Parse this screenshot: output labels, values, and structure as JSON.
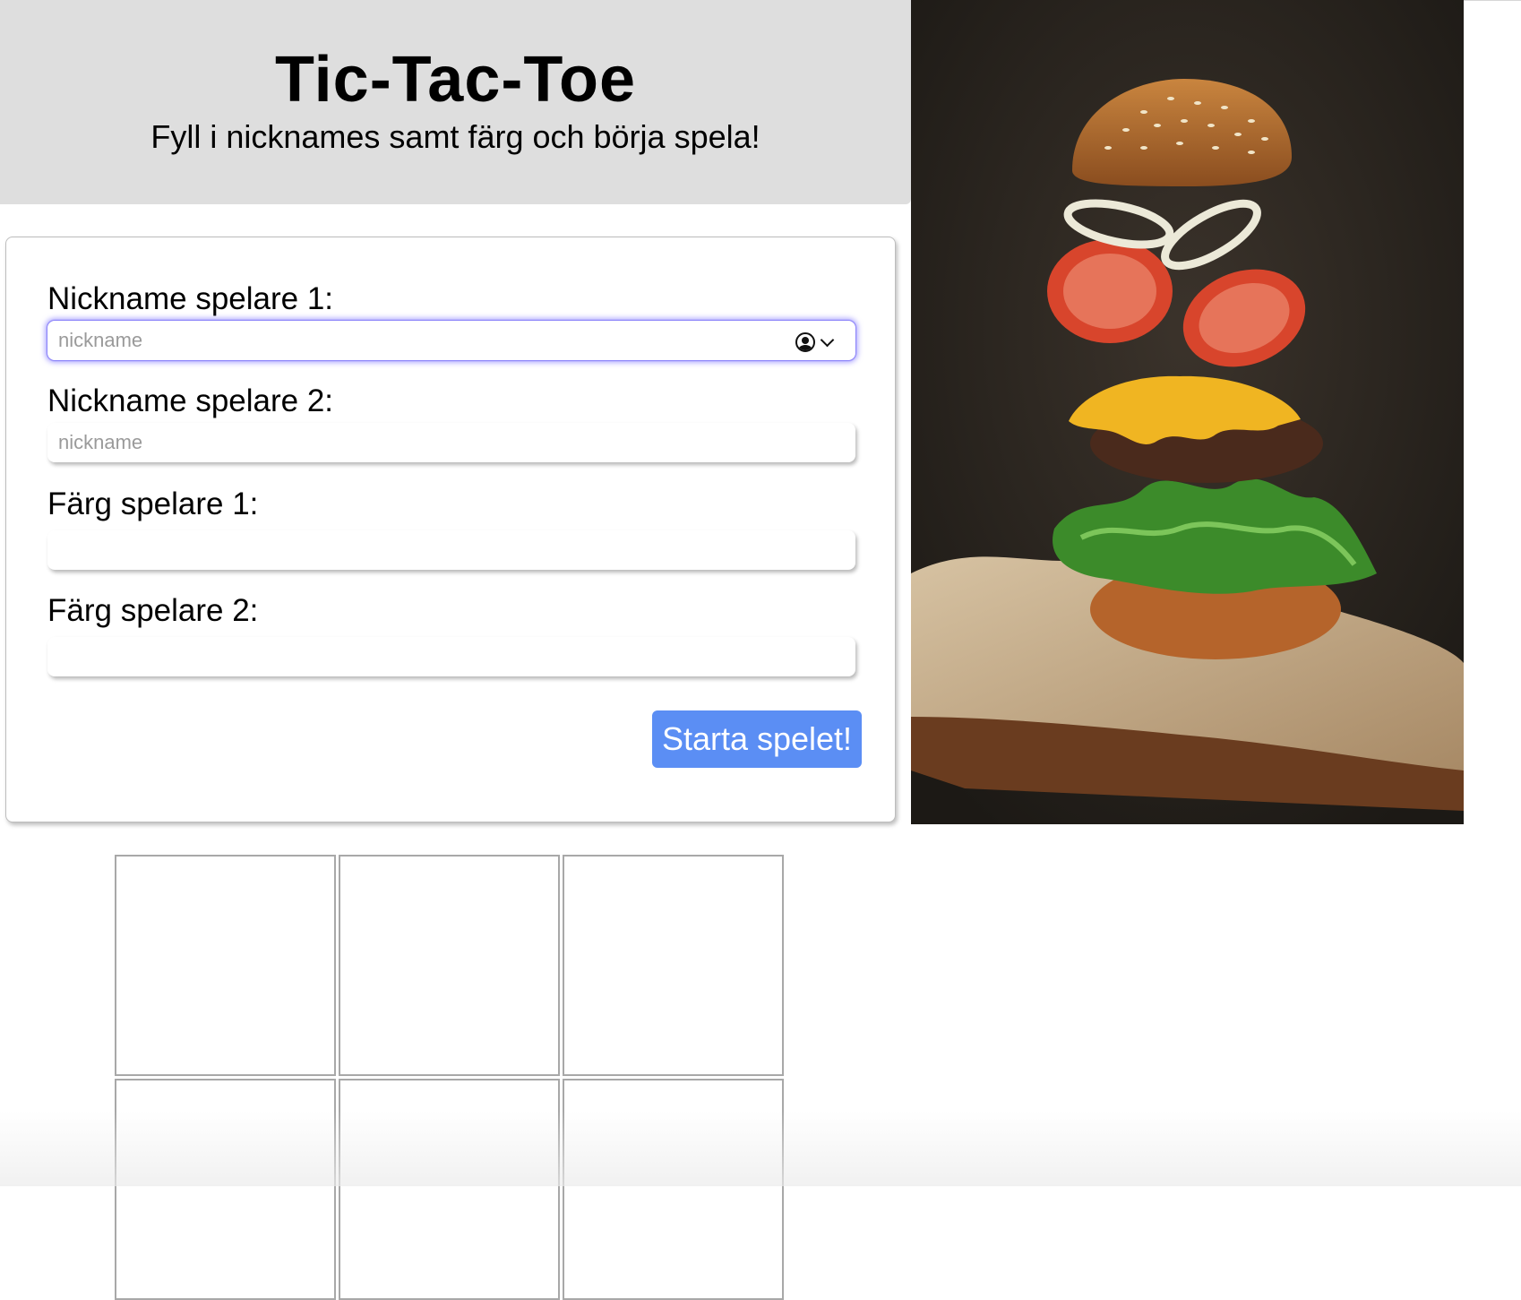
{
  "header": {
    "title": "Tic-Tac-Toe",
    "subtitle": "Fyll i nicknames samt färg och börja spela!"
  },
  "form": {
    "player1_nickname_label": "Nickname spelare 1:",
    "player1_nickname_placeholder": "nickname",
    "player2_nickname_label": "Nickname spelare 2:",
    "player2_nickname_placeholder": "nickname",
    "player1_color_label": "Färg spelare 1:",
    "player2_color_label": "Färg spelare 2:",
    "start_button_label": "Starta spelet!"
  },
  "image": {
    "subject": "burger"
  },
  "board": {
    "cells": [
      "",
      "",
      "",
      "",
      "",
      ""
    ]
  },
  "colors": {
    "header_bg": "#dedede",
    "button_bg": "#5b8ef4",
    "focus_ring": "#7a6eff",
    "grid_line": "#a8a8a8"
  }
}
